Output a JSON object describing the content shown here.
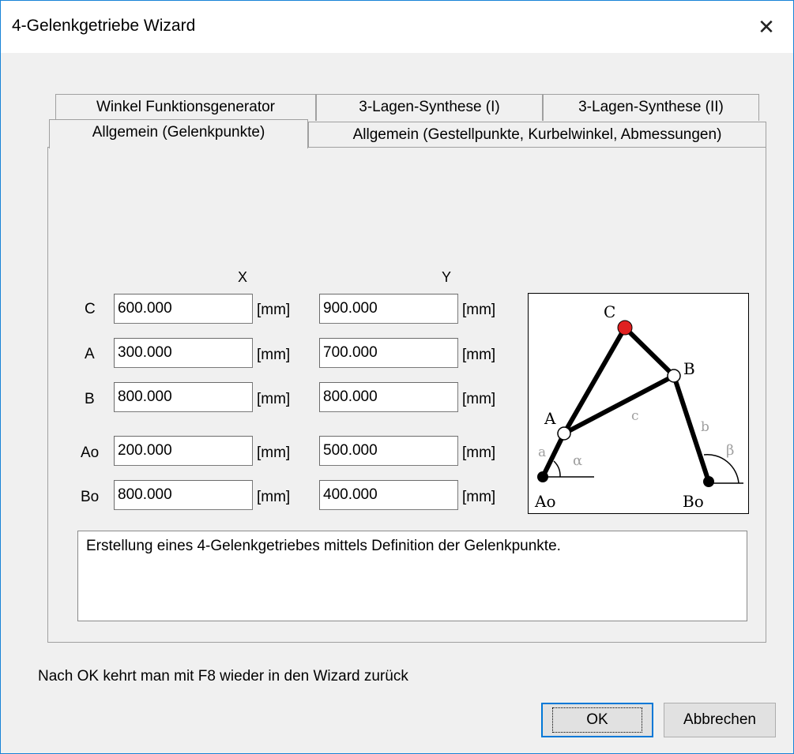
{
  "window": {
    "title": "4-Gelenkgetriebe Wizard",
    "close_glyph": "✕"
  },
  "tabs": {
    "back_row": [
      "Winkel Funktionsgenerator",
      "3-Lagen-Synthese (I)",
      "3-Lagen-Synthese (II)"
    ],
    "front_row": [
      "Allgemein (Gelenkpunkte)",
      "Allgemein (Gestellpunkte, Kurbelwinkel, Abmessungen)"
    ],
    "active": "Allgemein (Gelenkpunkte)"
  },
  "columns": {
    "x": "X",
    "y": "Y"
  },
  "unit": "[mm]",
  "points": [
    {
      "label": "C",
      "x": "600.000",
      "y": "900.000"
    },
    {
      "label": "A",
      "x": "300.000",
      "y": "700.000"
    },
    {
      "label": "B",
      "x": "800.000",
      "y": "800.000"
    },
    {
      "label": "Ao",
      "x": "200.000",
      "y": "500.000"
    },
    {
      "label": "Bo",
      "x": "800.000",
      "y": "400.000"
    }
  ],
  "figure": {
    "labels": {
      "C": "C",
      "B": "B",
      "A": "A",
      "Ao": "Ao",
      "Bo": "Bo",
      "a": "a",
      "b": "b",
      "c": "c",
      "alpha": "α",
      "beta": "β"
    },
    "colors": {
      "joint_c": "#e02020",
      "links": "#000000",
      "annotation": "#a0a0a0"
    }
  },
  "description": "Erstellung eines 4-Gelenkgetriebes mittels Definition der Gelenkpunkte.",
  "hint": "Nach OK kehrt man mit F8 wieder in den Wizard zurück",
  "buttons": {
    "ok": "OK",
    "cancel": "Abbrechen"
  }
}
